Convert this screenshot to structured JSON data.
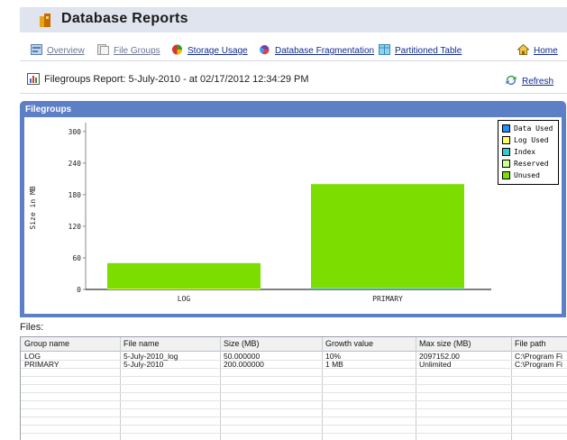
{
  "app": {
    "title": "Database Reports"
  },
  "nav": {
    "items": [
      {
        "label": "Overview",
        "icon": "overview-icon"
      },
      {
        "label": "File Groups",
        "icon": "file-groups-icon"
      },
      {
        "label": "Storage Usage",
        "icon": "storage-usage-icon"
      },
      {
        "label": "Database Fragmentation",
        "icon": "fragmentation-icon"
      },
      {
        "label": "Partitioned Table",
        "icon": "partitioned-table-icon"
      }
    ],
    "home_label": "Home"
  },
  "report": {
    "title": "Filegroups Report: 5-July-2010 - at 02/17/2012 12:34:29 PM",
    "refresh_label": "Refresh"
  },
  "panel": {
    "title": "Filegroups"
  },
  "colors": {
    "data_used": "#1e90ff",
    "log_used": "#ffff66",
    "index": "#33cccc",
    "reserved": "#ccff99",
    "unused": "#7cdd00",
    "panel_header": "#5d7fc6"
  },
  "chart_data": {
    "type": "bar",
    "stacked": true,
    "categories": [
      "LOG",
      "PRIMARY"
    ],
    "series": [
      {
        "name": "Data Used",
        "values": [
          0,
          1.5
        ]
      },
      {
        "name": "Log Used",
        "values": [
          1.2,
          0
        ]
      },
      {
        "name": "Index",
        "values": [
          0,
          0.5
        ]
      },
      {
        "name": "Reserved",
        "values": [
          0,
          0.3
        ]
      },
      {
        "name": "Unused",
        "values": [
          48.8,
          197.7
        ]
      }
    ],
    "ylabel": "Size in MB",
    "yticks": [
      0,
      60,
      120,
      180,
      240,
      300
    ],
    "ylim": [
      0,
      310
    ],
    "legend_position": "top-right",
    "grid": false
  },
  "files": {
    "label": "Files:",
    "columns": [
      "Group name",
      "File name",
      "Size (MB)",
      "Growth value",
      "Max size (MB)",
      "File path"
    ],
    "rows": [
      [
        "LOG",
        "5-July-2010_log",
        "50.000000",
        "10%",
        "2097152.00",
        "C:\\Program Fi"
      ],
      [
        "PRIMARY",
        "5-July-2010",
        "200.000000",
        "1 MB",
        "Unlimited",
        "C:\\Program Fi"
      ]
    ]
  }
}
